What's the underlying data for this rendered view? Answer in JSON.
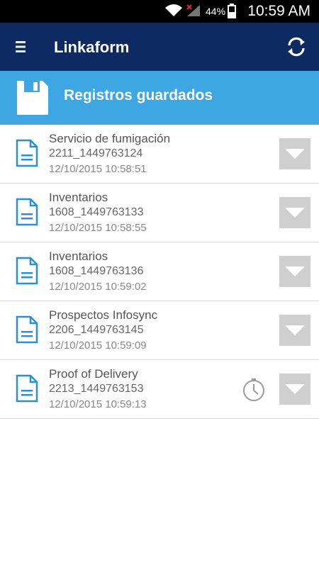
{
  "status_bar": {
    "battery_percent": "44%",
    "time": "10:59 AM"
  },
  "app": {
    "title": "Linkaform"
  },
  "section": {
    "title": "Registros guardados"
  },
  "records": [
    {
      "name": "Servicio de fumigación",
      "code": "2211_1449763124",
      "date": "12/10/2015 10:58:51",
      "pending": false
    },
    {
      "name": "Inventarios",
      "code": "1608_1449763133",
      "date": "12/10/2015 10:58:55",
      "pending": false
    },
    {
      "name": "Inventarios",
      "code": "1608_1449763136",
      "date": "12/10/2015 10:59:02",
      "pending": false
    },
    {
      "name": "Prospectos Infosync",
      "code": "2206_1449763145",
      "date": "12/10/2015 10:59:09",
      "pending": false
    },
    {
      "name": "Proof of Delivery",
      "code": "2213_1449763153",
      "date": "12/10/2015 10:59:13",
      "pending": true
    }
  ],
  "icons": {
    "menu": "menu-icon",
    "refresh": "refresh-icon",
    "save": "save-icon",
    "document": "document-icon",
    "dropdown": "chevron-down-icon",
    "clock": "clock-icon"
  },
  "colors": {
    "app_bar": "#0d2a62",
    "section_header": "#3ea6e2",
    "icon_blue": "#2a8fd6",
    "dropdown_bg": "#cfcfcf"
  }
}
